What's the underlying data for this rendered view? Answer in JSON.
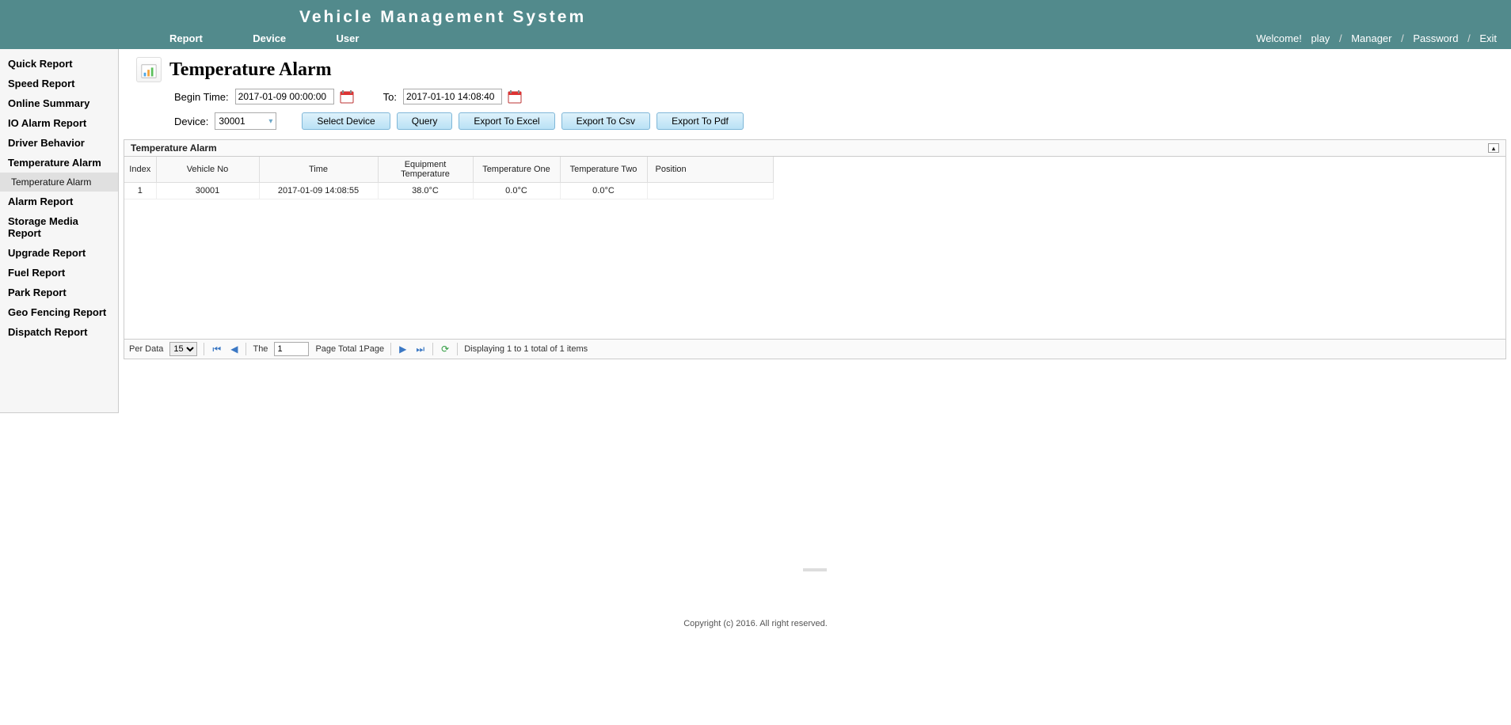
{
  "app_title": "Vehicle Management System",
  "top_nav": [
    "Report",
    "Device",
    "User"
  ],
  "user_bar": {
    "welcome": "Welcome!",
    "username": "play",
    "links": [
      "Manager",
      "Password",
      "Exit"
    ]
  },
  "sidebar": {
    "items": [
      {
        "label": "Quick Report",
        "sub": []
      },
      {
        "label": "Speed Report",
        "sub": []
      },
      {
        "label": "Online Summary",
        "sub": []
      },
      {
        "label": "IO Alarm Report",
        "sub": []
      },
      {
        "label": "Driver Behavior",
        "sub": []
      },
      {
        "label": "Temperature Alarm",
        "sub": [
          "Temperature Alarm"
        ]
      },
      {
        "label": "Alarm Report",
        "sub": []
      },
      {
        "label": "Storage Media Report",
        "sub": []
      },
      {
        "label": "Upgrade Report",
        "sub": []
      },
      {
        "label": "Fuel Report",
        "sub": []
      },
      {
        "label": "Park Report",
        "sub": []
      },
      {
        "label": "Geo Fencing Report",
        "sub": []
      },
      {
        "label": "Dispatch Report",
        "sub": []
      }
    ]
  },
  "page": {
    "title": "Temperature Alarm",
    "begin_time_label": "Begin Time:",
    "begin_time_value": "2017-01-09 00:00:00",
    "to_label": "To:",
    "to_value": "2017-01-10 14:08:40",
    "device_label": "Device:",
    "device_value": "30001",
    "buttons": {
      "select_device": "Select Device",
      "query": "Query",
      "export_excel": "Export To Excel",
      "export_csv": "Export To Csv",
      "export_pdf": "Export To Pdf"
    }
  },
  "grid": {
    "title": "Temperature Alarm",
    "columns": [
      "Index",
      "Vehicle No",
      "Time",
      "Equipment Temperature",
      "Temperature One",
      "Temperature Two",
      "Position"
    ],
    "rows": [
      {
        "index": "1",
        "vehicle_no": "30001",
        "time": "2017-01-09 14:08:55",
        "eq_temp": "38.0°C",
        "t1": "0.0°C",
        "t2": "0.0°C",
        "position": ""
      }
    ]
  },
  "pager": {
    "per_data_label": "Per Data",
    "per_data_value": "15",
    "the_label": "The",
    "page_value": "1",
    "page_total_label": "Page  Total 1Page",
    "displaying": "Displaying 1 to 1 total of 1 items"
  },
  "footer": "Copyright (c) 2016. All right reserved."
}
